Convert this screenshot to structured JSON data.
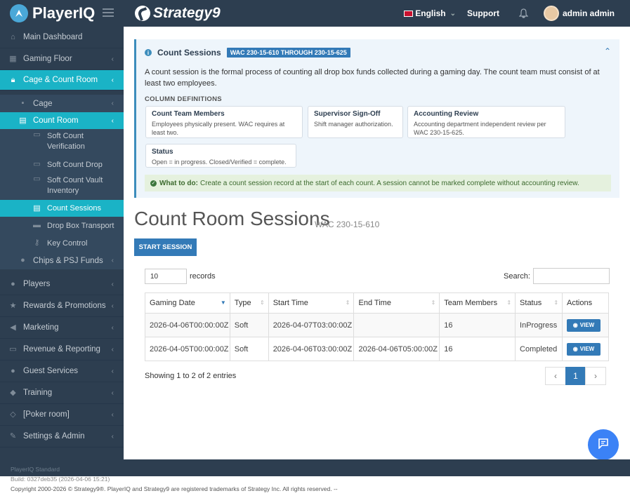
{
  "header": {
    "brand": "PlayerIQ",
    "partner_logo": "Strategy9",
    "language": "English",
    "support": "Support",
    "user": "admin admin"
  },
  "sidebar": {
    "items": [
      {
        "label": "Main Dashboard",
        "icon": "home-icon"
      },
      {
        "label": "Gaming Floor",
        "icon": "grid-icon"
      },
      {
        "label": "Cage & Count Room",
        "icon": "lock-icon"
      },
      {
        "label": "Cage",
        "icon": "lock-icon"
      },
      {
        "label": "Count Room",
        "icon": "calculator-icon"
      },
      {
        "label": "Soft Count Verification",
        "icon": "money-icon"
      },
      {
        "label": "Soft Count Drop",
        "icon": "money-icon"
      },
      {
        "label": "Soft Count Vault Inventory",
        "icon": "money-icon"
      },
      {
        "label": "Count Sessions",
        "icon": "calculator-icon"
      },
      {
        "label": "Drop Box Transport",
        "icon": "truck-icon"
      },
      {
        "label": "Key Control",
        "icon": "key-icon"
      },
      {
        "label": "Chips & PSJ Funds",
        "icon": "chip-icon"
      },
      {
        "label": "Players",
        "icon": "user-icon"
      },
      {
        "label": "Rewards & Promotions",
        "icon": "star-icon"
      },
      {
        "label": "Marketing",
        "icon": "megaphone-icon"
      },
      {
        "label": "Revenue & Reporting",
        "icon": "money-icon"
      },
      {
        "label": "Guest Services",
        "icon": "users-icon"
      },
      {
        "label": "Training",
        "icon": "graduation-cap-icon"
      },
      {
        "label": "[Poker room]",
        "icon": "diamond-icon"
      },
      {
        "label": "Settings & Admin",
        "icon": "wrench-icon"
      }
    ]
  },
  "info_panel": {
    "title": "Count Sessions",
    "badge": "WAC 230-15-610 THROUGH 230-15-625",
    "description": "A count session is the formal process of counting all drop box funds collected during a gaming day. The count team must consist of at least two employees.",
    "definitions_heading": "COLUMN DEFINITIONS",
    "definitions": [
      {
        "term": "Count Team Members",
        "text": "Employees physically present. WAC requires at least two."
      },
      {
        "term": "Supervisor Sign-Off",
        "text": "Shift manager authorization."
      },
      {
        "term": "Accounting Review",
        "text": "Accounting department independent review per WAC 230-15-625."
      },
      {
        "term": "Status",
        "text": "Open = in progress. Closed/Verified = complete."
      }
    ],
    "todo_label": "What to do:",
    "todo_text": "Create a count session record at the start of each count. A session cannot be marked complete without accounting review."
  },
  "page": {
    "title": "Count Room Sessions",
    "subtitle": "WAC 230-15-610",
    "start_button": "START SESSION",
    "length_value": "10",
    "length_suffix": "records",
    "search_label": "Search:"
  },
  "table": {
    "headers": [
      "Gaming Date",
      "Type",
      "Start Time",
      "End Time",
      "Team Members",
      "Status",
      "Actions"
    ],
    "rows": [
      [
        "2026-04-06T00:00:00Z",
        "Soft",
        "2026-04-07T03:00:00Z",
        "",
        "16",
        "InProgress",
        "VIEW"
      ],
      [
        "2026-04-05T00:00:00Z",
        "Soft",
        "2026-04-06T03:00:00Z",
        "2026-04-06T05:00:00Z",
        "16",
        "Completed",
        "VIEW"
      ]
    ],
    "footer": "Showing 1 to 2 of 2 entries",
    "pager": [
      "‹",
      "1",
      "›"
    ]
  },
  "footer": {
    "version": "PlayerIQ Standard",
    "build": "Build: 0327deb35 (2026-04-06 15:21)",
    "copyright": "Copyright 2000-2026 © Strategy9®. PlayerIQ and Strategy9 are registered trademarks of Strategy Inc. All rights reserved. --"
  }
}
